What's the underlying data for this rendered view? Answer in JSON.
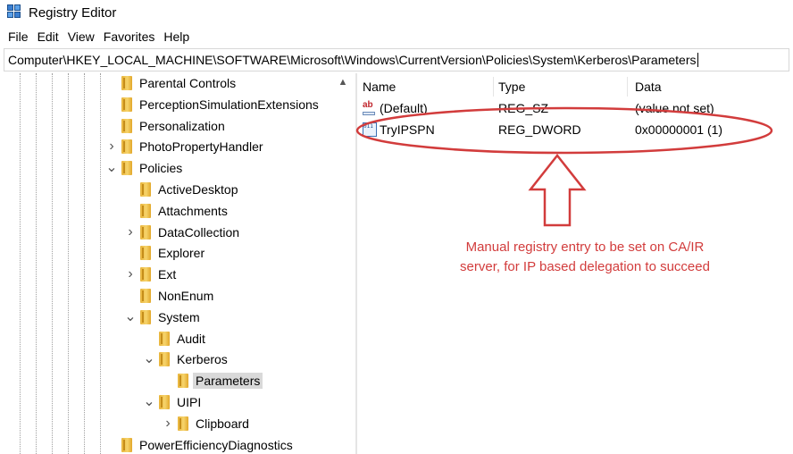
{
  "window": {
    "title": "Registry Editor"
  },
  "menu": [
    "File",
    "Edit",
    "View",
    "Favorites",
    "Help"
  ],
  "address": "Computer\\HKEY_LOCAL_MACHINE\\SOFTWARE\\Microsoft\\Windows\\CurrentVersion\\Policies\\System\\Kerberos\\Parameters",
  "tree": [
    {
      "label": "Parental Controls",
      "level": 0,
      "expander": ""
    },
    {
      "label": "PerceptionSimulationExtensions",
      "level": 0,
      "expander": ""
    },
    {
      "label": "Personalization",
      "level": 0,
      "expander": ""
    },
    {
      "label": "PhotoPropertyHandler",
      "level": 0,
      "expander": "collapsed"
    },
    {
      "label": "Policies",
      "level": 0,
      "expander": "expanded"
    },
    {
      "label": "ActiveDesktop",
      "level": 1,
      "expander": ""
    },
    {
      "label": "Attachments",
      "level": 1,
      "expander": ""
    },
    {
      "label": "DataCollection",
      "level": 1,
      "expander": "collapsed"
    },
    {
      "label": "Explorer",
      "level": 1,
      "expander": ""
    },
    {
      "label": "Ext",
      "level": 1,
      "expander": "collapsed"
    },
    {
      "label": "NonEnum",
      "level": 1,
      "expander": ""
    },
    {
      "label": "System",
      "level": 1,
      "expander": "expanded"
    },
    {
      "label": "Audit",
      "level": 2,
      "expander": ""
    },
    {
      "label": "Kerberos",
      "level": 2,
      "expander": "expanded"
    },
    {
      "label": "Parameters",
      "level": 3,
      "expander": "",
      "selected": true
    },
    {
      "label": "UIPI",
      "level": 2,
      "expander": "expanded"
    },
    {
      "label": "Clipboard",
      "level": 3,
      "expander": "collapsed"
    },
    {
      "label": "PowerEfficiencyDiagnostics",
      "level": 0,
      "expander": ""
    }
  ],
  "columns": {
    "name": "Name",
    "type": "Type",
    "data": "Data"
  },
  "values": [
    {
      "icon": "string-value-icon",
      "name": "(Default)",
      "type": "REG_SZ",
      "data": "(value not set)"
    },
    {
      "icon": "binary-value-icon",
      "name": "TryIPSPN",
      "type": "REG_DWORD",
      "data": "0x00000001 (1)"
    }
  ],
  "annotation": {
    "line1": "Manual registry entry to be set on CA/IR",
    "line2": "server, for IP based delegation to succeed",
    "color": "#d23c3c"
  },
  "icons": {
    "app": "registry-editor-icon",
    "ab": "ab",
    "bin": "011 110 011"
  }
}
